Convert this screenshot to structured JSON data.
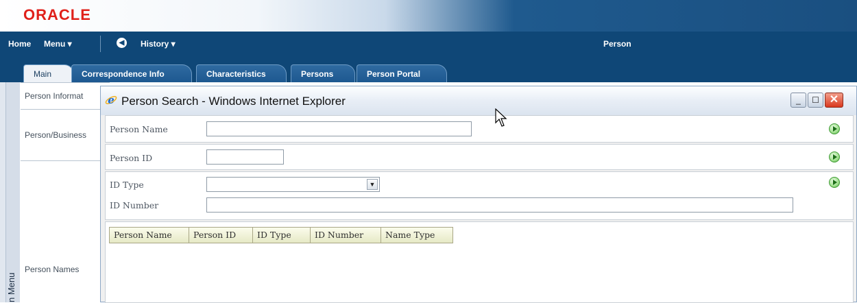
{
  "header": {
    "brand": "ORACLE"
  },
  "nav": {
    "home": "Home",
    "menu": "Menu ▾",
    "back_icon": "◀",
    "history": "History ▾",
    "page_title": "Person"
  },
  "tabs": [
    {
      "label": "Main",
      "active": true
    },
    {
      "label": "Correspondence Info"
    },
    {
      "label": "Characteristics"
    },
    {
      "label": "Persons"
    },
    {
      "label": "Person Portal"
    }
  ],
  "side_menu": {
    "label": "n Menu"
  },
  "main": {
    "sections": [
      {
        "label": "Person Informat"
      },
      {
        "label": "Person/Business"
      },
      {
        "label": "Person Names"
      }
    ]
  },
  "dialog": {
    "title": "Person Search - Windows Internet Explorer",
    "min_icon": "_",
    "max_icon": "☐",
    "close_icon": "✕",
    "form": {
      "person_name_label": "Person Name",
      "person_name_value": "",
      "person_id_label": "Person ID",
      "person_id_value": "",
      "id_type_label": "ID Type",
      "id_type_value": "",
      "id_number_label": "ID Number",
      "id_number_value": ""
    },
    "results_columns": [
      "Person Name",
      "Person ID",
      "ID Type",
      "ID Number",
      "Name Type"
    ]
  },
  "colors": {
    "brand_red": "#e0201a",
    "nav_blue": "#0f4777",
    "go_green": "#4aa63c"
  }
}
